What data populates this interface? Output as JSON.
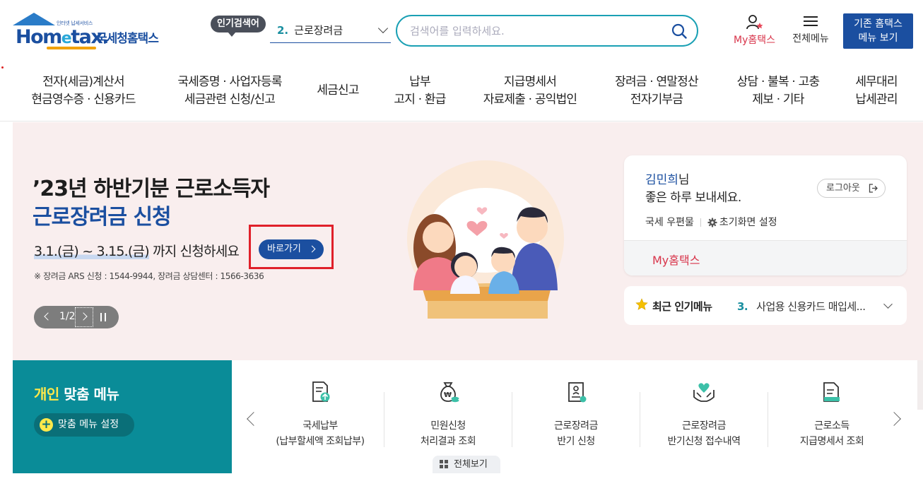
{
  "header": {
    "logo_small": "인터넷 납세서비스",
    "logo_word_a": "Hom",
    "logo_word_e": "e",
    "logo_word_b": "tax.",
    "logo_kr": "국세청홈택스",
    "popular_tag": "인기검색어",
    "popular_rank": "2.",
    "popular_term": "근로장려금",
    "search_placeholder": "검색어를 입력하세요.",
    "my_hometax": "My홈택스",
    "menu_all": "전체메뉴",
    "legacy_line1": "기존 홈택스",
    "legacy_line2": "메뉴 보기"
  },
  "nav": [
    {
      "l1": "전자(세금)계산서",
      "l2": "현금영수증 · 신용카드"
    },
    {
      "l1": "국세증명 · 사업자등록",
      "l2": "세금관련 신청/신고"
    },
    {
      "l1": "세금신고",
      "l2": ""
    },
    {
      "l1": "납부",
      "l2": "고지 · 환급"
    },
    {
      "l1": "지급명세서",
      "l2": "자료제출 · 공익법인"
    },
    {
      "l1": "장려금 · 연말정산",
      "l2": "전자기부금"
    },
    {
      "l1": "상담 · 불복 · 고충",
      "l2": "제보 · 기타"
    },
    {
      "l1": "세무대리",
      "l2": "납세관리"
    }
  ],
  "banner": {
    "title_line1": "’23년 하반기분 근로소득자",
    "title_line2": "근로장려금 신청",
    "date_text": "3.1.(금) ~ 3.15.(금)",
    "date_suffix": " 까지 신청하세요",
    "go_button": "바로가기",
    "note": "※ 장려금 ARS 신청 : 1544-9944, 장려금 상담센터 : 1566-3636",
    "slide_counter": "1/2"
  },
  "login": {
    "user_name": "김민희",
    "honorific": "님",
    "greeting": "좋은 하루 보내세요.",
    "logout": "로그아웃",
    "mailbox": "국세 우편물",
    "home_settings": "초기화면 설정",
    "my_hometax": "My홈택스"
  },
  "recent": {
    "title": "최근 인기메뉴",
    "rank": "3.",
    "item": "사업용 신용카드 매입세..."
  },
  "personal": {
    "title_highlight": "개인",
    "title_rest": " 맞춤 메뉴",
    "settings_button": "맞춤 메뉴 설정"
  },
  "quick_menu": [
    {
      "l1": "국세납부",
      "l2": "(납부할세액 조회납부)",
      "icon": "tax-payment-icon"
    },
    {
      "l1": "민원신청",
      "l2": "처리결과 조회",
      "icon": "money-bag-icon"
    },
    {
      "l1": "근로장려금",
      "l2": "반기 신청",
      "icon": "certificate-icon"
    },
    {
      "l1": "근로장려금",
      "l2": "반기신청 접수내역",
      "icon": "heart-hands-icon"
    },
    {
      "l1": "근로소득",
      "l2": "지급명세서 조회",
      "icon": "document-icon"
    }
  ],
  "view_all": "전체보기",
  "colors": {
    "brand_blue": "#1b4fa0",
    "teal": "#0a8c98",
    "banner_bg": "#f9eeee",
    "accent_red": "#d8344a"
  }
}
